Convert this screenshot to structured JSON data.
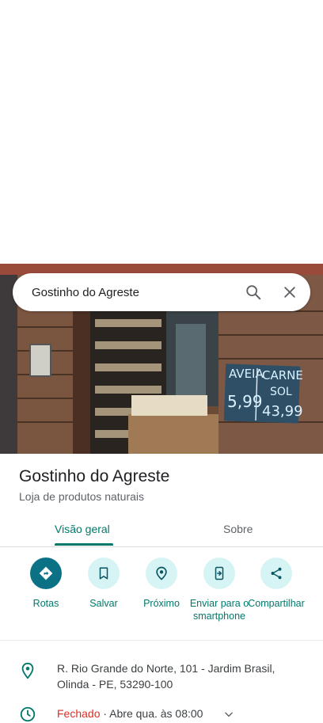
{
  "search": {
    "query": "Gostinho do Agreste"
  },
  "place": {
    "name": "Gostinho do Agreste",
    "category": "Loja de produtos naturais"
  },
  "tabs": [
    {
      "label": "Visão geral"
    },
    {
      "label": "Sobre"
    }
  ],
  "actions": [
    {
      "label": "Rotas"
    },
    {
      "label": "Salvar"
    },
    {
      "label": "Próximo"
    },
    {
      "label": "Enviar para o smartphone"
    },
    {
      "label": "Compartilhar"
    }
  ],
  "info": {
    "address_line1": "R. Rio Grande do Norte, 101 - Jardim Brasil,",
    "address_line2": "Olinda - PE, 53290-100",
    "hours_status": "Fechado",
    "hours_detail": " · Abre qua. às 08:00"
  },
  "photo_sign": {
    "left": "AVEIA",
    "right": "CARNE",
    "right2": "SOL",
    "price1": "5,99",
    "price2": "43,99"
  },
  "colors": {
    "accent": "#00796b",
    "primary_button": "#0b7285",
    "closed": "#d93025"
  }
}
